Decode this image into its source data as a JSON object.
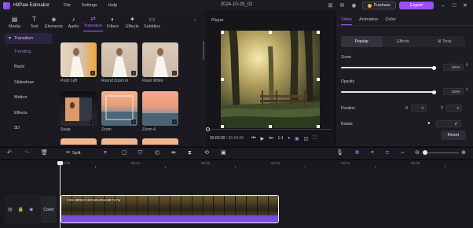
{
  "titlebar": {
    "app_name": "HitPaw Edimakor",
    "menu": [
      "File",
      "Settings",
      "Help"
    ],
    "window_title": "2024-10-25_02",
    "purchase_label": "Purchase",
    "export_label": "Export",
    "colors": {
      "accent": "#9b4dff",
      "coin": "#f2b32f"
    }
  },
  "categories": [
    {
      "label": "Media",
      "icon": "media-icon"
    },
    {
      "label": "Text",
      "icon": "text-icon"
    },
    {
      "label": "Elements",
      "icon": "elements-icon"
    },
    {
      "label": "Audio",
      "icon": "audio-icon"
    },
    {
      "label": "Transition",
      "icon": "transition-icon",
      "active": true
    },
    {
      "label": "Filters",
      "icon": "filters-icon"
    },
    {
      "label": "Effects",
      "icon": "effects-icon"
    },
    {
      "label": "Subtitles",
      "icon": "subtitles-icon"
    }
  ],
  "sidebar": {
    "header": "Transition",
    "items": [
      "Trending",
      "Basic",
      "Slideshow",
      "Motion",
      "Effects",
      "3D"
    ],
    "active": "Trending"
  },
  "tiles": [
    {
      "label": "Push Left"
    },
    {
      "label": "Round Zoom in"
    },
    {
      "label": "Flash White"
    },
    {
      "label": "Swap"
    },
    {
      "label": "Zoom"
    },
    {
      "label": "Zoom 4"
    }
  ],
  "player": {
    "label": "Player",
    "time_current": "00:00:00",
    "time_separator": " / ",
    "time_total": "00:03:00",
    "speed": "1:1"
  },
  "properties": {
    "tabs": [
      "Video",
      "Animation",
      "Color"
    ],
    "active_tab": "Video",
    "segments": [
      "Popular",
      "Effects",
      "AI Tools"
    ],
    "active_segment": "Popular",
    "zoom": {
      "label": "Zoom",
      "value": "100%",
      "level_percent": 100
    },
    "opacity": {
      "label": "Opacity",
      "value": "100%",
      "level_percent": 100
    },
    "position": {
      "label": "Position",
      "x_label": "X",
      "x": "0",
      "y_label": "Y",
      "y": "0"
    },
    "rotate": {
      "label": "Rotate",
      "value": "0°"
    },
    "reset_label": "Reset"
  },
  "toolbar": {
    "split_label": "Split"
  },
  "timeline": {
    "ticks": [
      "00:00",
      "00:01",
      "00:02",
      "00:03",
      "00:04",
      "00:05"
    ],
    "cover_label": "Cover",
    "clip_name": "0:03 d8R5C18CN264Onn9E7A7w"
  }
}
